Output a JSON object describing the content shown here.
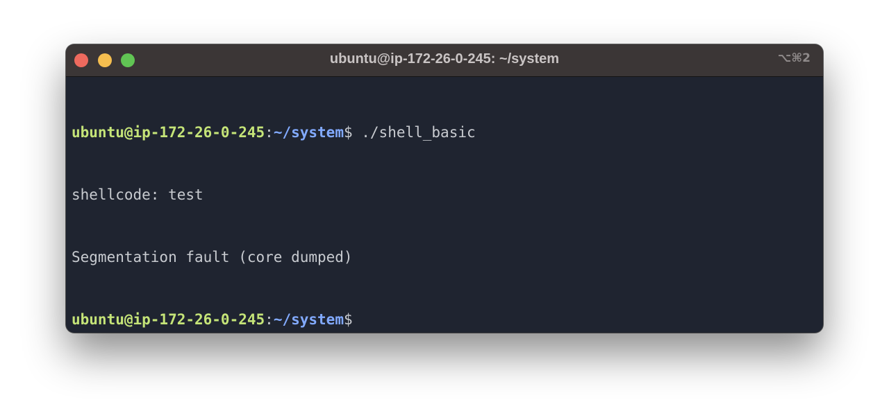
{
  "window": {
    "title": "ubuntu@ip-172-26-0-245: ~/system",
    "shortcut": "⌥⌘2"
  },
  "terminal": {
    "prompt_user": "ubuntu@ip-172-26-0-245",
    "prompt_colon": ":",
    "prompt_path": "~/system",
    "prompt_symbol": "$",
    "command": " ./shell_basic",
    "output_lines": [
      "shellcode: test",
      "Segmentation fault (core dumped)"
    ]
  },
  "colors": {
    "prompt_user": "#c5e478",
    "prompt_path": "#82aaff",
    "background": "#1f2430",
    "titlebar": "#3b3636"
  }
}
